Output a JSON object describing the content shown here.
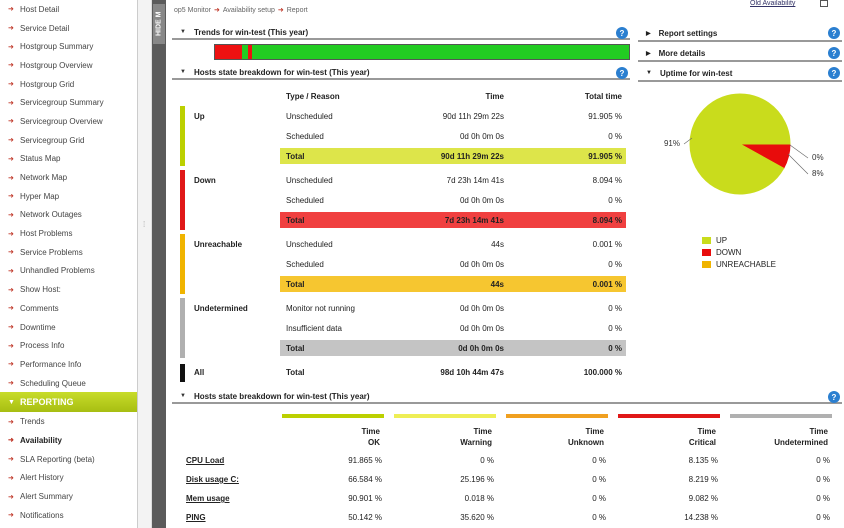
{
  "sidebar": {
    "items": [
      {
        "label": "Host Detail"
      },
      {
        "label": "Service Detail"
      },
      {
        "label": "Hostgroup Summary"
      },
      {
        "label": "Hostgroup Overview"
      },
      {
        "label": "Hostgroup Grid"
      },
      {
        "label": "Servicegroup Summary"
      },
      {
        "label": "Servicegroup Overview"
      },
      {
        "label": "Servicegroup Grid"
      },
      {
        "label": "Status Map"
      },
      {
        "label": "Network Map"
      },
      {
        "label": "Hyper Map"
      },
      {
        "label": "Network Outages"
      },
      {
        "label": "Host Problems"
      },
      {
        "label": "Service Problems"
      },
      {
        "label": "Unhandled Problems"
      },
      {
        "label": "Show Host:"
      },
      {
        "label": "Comments"
      },
      {
        "label": "Downtime"
      },
      {
        "label": "Process Info"
      },
      {
        "label": "Performance Info"
      },
      {
        "label": "Scheduling Queue"
      }
    ],
    "reporting_header": "REPORTING",
    "reporting_items": [
      {
        "label": "Trends"
      },
      {
        "label": "Availability"
      },
      {
        "label": "SLA Reporting (beta)"
      },
      {
        "label": "Alert History"
      },
      {
        "label": "Alert Summary"
      },
      {
        "label": "Notifications"
      }
    ],
    "hide_menu_label": "HIDE M"
  },
  "breadcrumb": [
    "op5 Monitor",
    "Availability setup",
    "Report"
  ],
  "top_link": "Old Availability",
  "trends": {
    "title": "Trends for win-test  (This year)",
    "segments": [
      {
        "state": "down",
        "color": "#ee1111",
        "share": 0.065
      },
      {
        "state": "up",
        "color": "#22cc22",
        "share": 0.015
      },
      {
        "state": "down",
        "color": "#ee1111",
        "share": 0.01
      },
      {
        "state": "up",
        "color": "#22cc22",
        "share": 0.91
      }
    ]
  },
  "state_table": {
    "title": "Hosts state breakdown for win-test  (This year)",
    "headers": {
      "type": "Type / Reason",
      "time": "Time",
      "total": "Total time"
    },
    "groups": [
      {
        "label": "Up",
        "color": "#bcd000",
        "total_color": "#dde54a",
        "rows": [
          {
            "type": "Unscheduled",
            "time": "90d 11h 29m 22s",
            "total": "91.905 %"
          },
          {
            "type": "Scheduled",
            "time": "0d 0h 0m 0s",
            "total": "0 %"
          }
        ],
        "total": {
          "type": "Total",
          "time": "90d 11h 29m 22s",
          "total": "91.905 %"
        }
      },
      {
        "label": "Down",
        "color": "#e01818",
        "total_color": "#f04040",
        "rows": [
          {
            "type": "Unscheduled",
            "time": "7d 23h 14m 41s",
            "total": "8.094 %"
          },
          {
            "type": "Scheduled",
            "time": "0d 0h 0m 0s",
            "total": "0 %"
          }
        ],
        "total": {
          "type": "Total",
          "time": "7d 23h 14m 41s",
          "total": "8.094 %"
        }
      },
      {
        "label": "Unreachable",
        "color": "#f0b400",
        "total_color": "#f6c630",
        "rows": [
          {
            "type": "Unscheduled",
            "time": "44s",
            "total": "0.001 %"
          },
          {
            "type": "Scheduled",
            "time": "0d 0h 0m 0s",
            "total": "0 %"
          }
        ],
        "total": {
          "type": "Total",
          "time": "44s",
          "total": "0.001 %"
        }
      },
      {
        "label": "Undetermined",
        "color": "#b0b0b0",
        "total_color": "#c4c4c4",
        "rows": [
          {
            "type": "Monitor not running",
            "time": "0d 0h 0m 0s",
            "total": "0 %"
          },
          {
            "type": "Insufficient data",
            "time": "0d 0h 0m 0s",
            "total": "0 %"
          }
        ],
        "total": {
          "type": "Total",
          "time": "0d 0h 0m 0s",
          "total": "0 %"
        }
      }
    ],
    "all": {
      "label": "All",
      "type": "Total",
      "time": "98d 10h 44m 47s",
      "total": "100.000 %"
    }
  },
  "right_panels": {
    "report_settings": "Report settings",
    "more_details": "More details",
    "uptime_title": "Uptime for win-test"
  },
  "chart_data": {
    "type": "pie",
    "title": "",
    "slices": [
      {
        "label": "UP",
        "value": 91.905,
        "color": "#c9dc1c",
        "display": "91%"
      },
      {
        "label": "DOWN",
        "value": 8.094,
        "color": "#e80c0c",
        "display": "8%"
      },
      {
        "label": "UNREACHABLE",
        "value": 0.001,
        "color": "#f0b400",
        "display": "0%"
      }
    ],
    "legend": [
      "UP",
      "DOWN",
      "UNREACHABLE"
    ],
    "legend_position": "bottom"
  },
  "bottom_table": {
    "title": "Hosts state breakdown for win-test  (This year)",
    "columns": [
      {
        "line1": "Time",
        "line2": "OK",
        "color": "#bcd000"
      },
      {
        "line1": "Time",
        "line2": "Warning",
        "color": "#eeee55"
      },
      {
        "line1": "Time",
        "line2": "Unknown",
        "color": "#f0a020"
      },
      {
        "line1": "Time",
        "line2": "Critical",
        "color": "#e01818"
      },
      {
        "line1": "Time",
        "line2": "Undetermined",
        "color": "#b0b0b0"
      }
    ],
    "rows": [
      {
        "name": "CPU Load",
        "values": [
          "91.865 %",
          "0 %",
          "0 %",
          "8.135 %",
          "0 %"
        ]
      },
      {
        "name": "Disk usage C:",
        "values": [
          "66.584 %",
          "25.196 %",
          "0 %",
          "8.219 %",
          "0 %"
        ]
      },
      {
        "name": "Mem usage",
        "values": [
          "90.901 %",
          "0.018 %",
          "0 %",
          "9.082 %",
          "0 %"
        ]
      },
      {
        "name": "PING",
        "values": [
          "50.142 %",
          "35.620 %",
          "0 %",
          "14.238 %",
          "0 %"
        ]
      }
    ]
  }
}
